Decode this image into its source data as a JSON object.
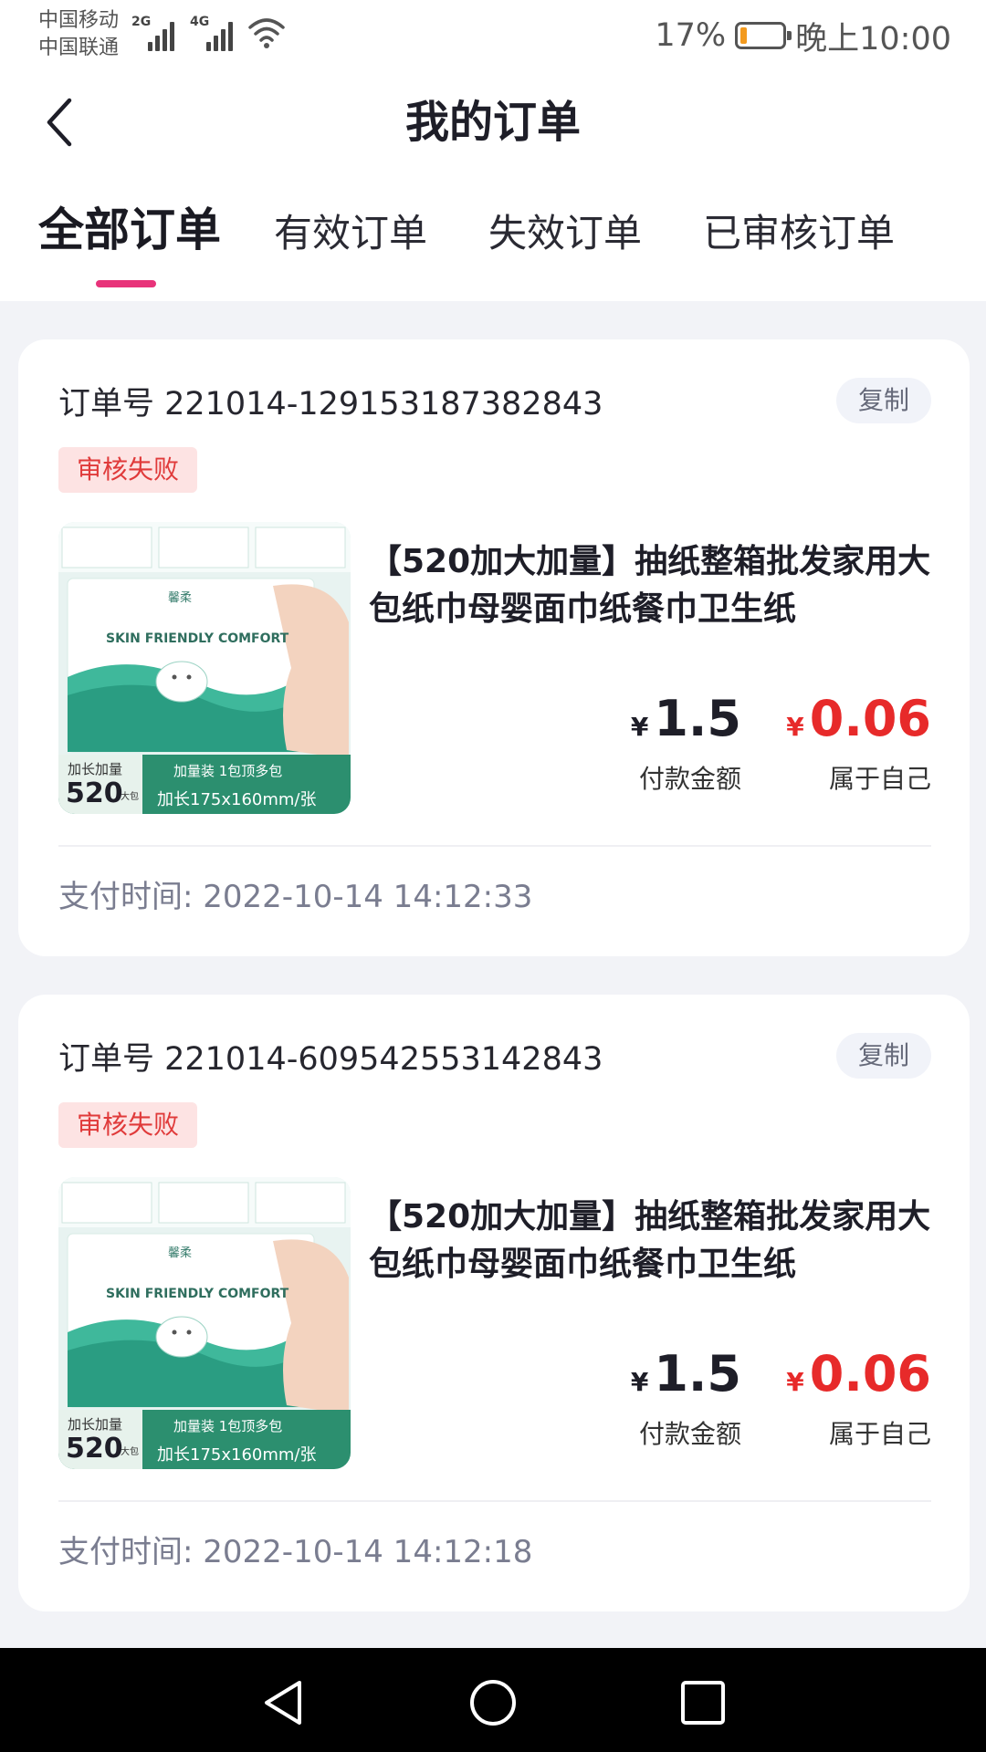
{
  "status_bar": {
    "carrier1": "中国移动",
    "carrier2": "中国联通",
    "net1": "2G",
    "net2": "4G",
    "battery_text": "17%",
    "battery_level": 0.17,
    "time": "晚上10:00"
  },
  "header": {
    "title": "我的订单"
  },
  "tabs": [
    {
      "label": "全部订单",
      "active": true
    },
    {
      "label": "有效订单",
      "active": false
    },
    {
      "label": "失效订单",
      "active": false
    },
    {
      "label": "已审核订单",
      "active": false
    }
  ],
  "orders": [
    {
      "order_id": "订单号 221014-129153187382843",
      "copy_label": "复制",
      "status": "审核失败",
      "product_name": "【520加大加量】抽纸整箱批发家用大包纸巾母婴面巾纸餐巾卫生纸",
      "pay_amount": "1.5",
      "pay_label": "付款金额",
      "own_amount": "0.06",
      "own_label": "属于自己",
      "currency": "¥",
      "pay_time_label": "支付时间:",
      "pay_time": "2022-10-14 14:12:33"
    },
    {
      "order_id": "订单号 221014-609542553142843",
      "copy_label": "复制",
      "status": "审核失败",
      "product_name": "【520加大加量】抽纸整箱批发家用大包纸巾母婴面巾纸餐巾卫生纸",
      "pay_amount": "1.5",
      "pay_label": "付款金额",
      "own_amount": "0.06",
      "own_label": "属于自己",
      "currency": "¥",
      "pay_time_label": "支付时间:",
      "pay_time": "2022-10-14 14:12:18"
    }
  ],
  "product_image": {
    "brand": "馨柔",
    "slogan": "SKIN FRIENDLY COMFORT",
    "count": "520",
    "count_unit": "大包",
    "tag1": "加长加量",
    "tag2": "加量装 1包顶多包",
    "tag3": "加长175x160mm/张"
  },
  "colors": {
    "accent_pink": "#e8337a",
    "price_red": "#e72a2a",
    "badge_bg": "#fde3e3",
    "page_bg": "#f2f3f7",
    "teal": "#2aa98a"
  },
  "icons": {
    "back": "chevron-left-icon",
    "wifi": "wifi-icon",
    "battery": "battery-icon",
    "nav_back": "triangle-back-icon",
    "nav_home": "circle-home-icon",
    "nav_recent": "square-recent-icon"
  }
}
